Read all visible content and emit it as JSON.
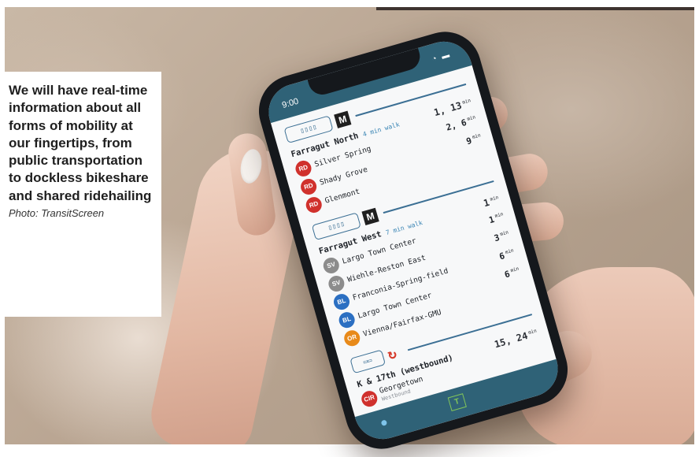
{
  "caption": {
    "text": "We will have real-time information about all forms of mobility at our fingertips, from public transportation to dockless bikeshare and shared ridehailing",
    "credit": "Photo: TransitScreen"
  },
  "phone": {
    "status_time": "9:00",
    "sections": [
      {
        "mode_icon": "metro-train-icon",
        "agency": "M",
        "stop": "Farragut North",
        "walk": "4 min walk",
        "stop_times": "1, 13",
        "min_label": "min",
        "routes": [
          {
            "badge": "RD",
            "color": "#d0312d",
            "dest": "Silver Spring",
            "sub": "",
            "mins": "2, 6"
          },
          {
            "badge": "RD",
            "color": "#d0312d",
            "dest": "Shady Grove",
            "sub": "",
            "mins": "9"
          },
          {
            "badge": "RD",
            "color": "#d0312d",
            "dest": "Glenmont",
            "sub": "",
            "mins": ""
          }
        ]
      },
      {
        "mode_icon": "metro-train-icon",
        "agency": "M",
        "stop": "Farragut West",
        "walk": "7 min walk",
        "stop_times": "1",
        "min_label": "min",
        "routes": [
          {
            "badge": "SV",
            "color": "#8c8c8c",
            "dest": "Largo Town Center",
            "sub": "",
            "mins": "1"
          },
          {
            "badge": "SV",
            "color": "#8c8c8c",
            "dest": "Wiehle-Reston East",
            "sub": "",
            "mins": "3"
          },
          {
            "badge": "BL",
            "color": "#2b6fc2",
            "dest": "Franconia-Spring-field",
            "sub": "",
            "mins": "6"
          },
          {
            "badge": "BL",
            "color": "#2b6fc2",
            "dest": "Largo Town Center",
            "sub": "",
            "mins": "6"
          },
          {
            "badge": "OR",
            "color": "#e88a1a",
            "dest": "Vienna/Fairfax-GMU",
            "sub": "",
            "mins": ""
          }
        ]
      },
      {
        "mode_icon": "bus-icon",
        "agency": "",
        "stop": "K & 17th (westbound)",
        "walk": "",
        "stop_times": "15, 24",
        "min_label": "min",
        "routes": [
          {
            "badge": "CIR",
            "color": "#d0312d",
            "dest": "Georgetown",
            "sub": "Westbound",
            "mins": ""
          }
        ]
      }
    ],
    "tab_t_label": "T"
  }
}
